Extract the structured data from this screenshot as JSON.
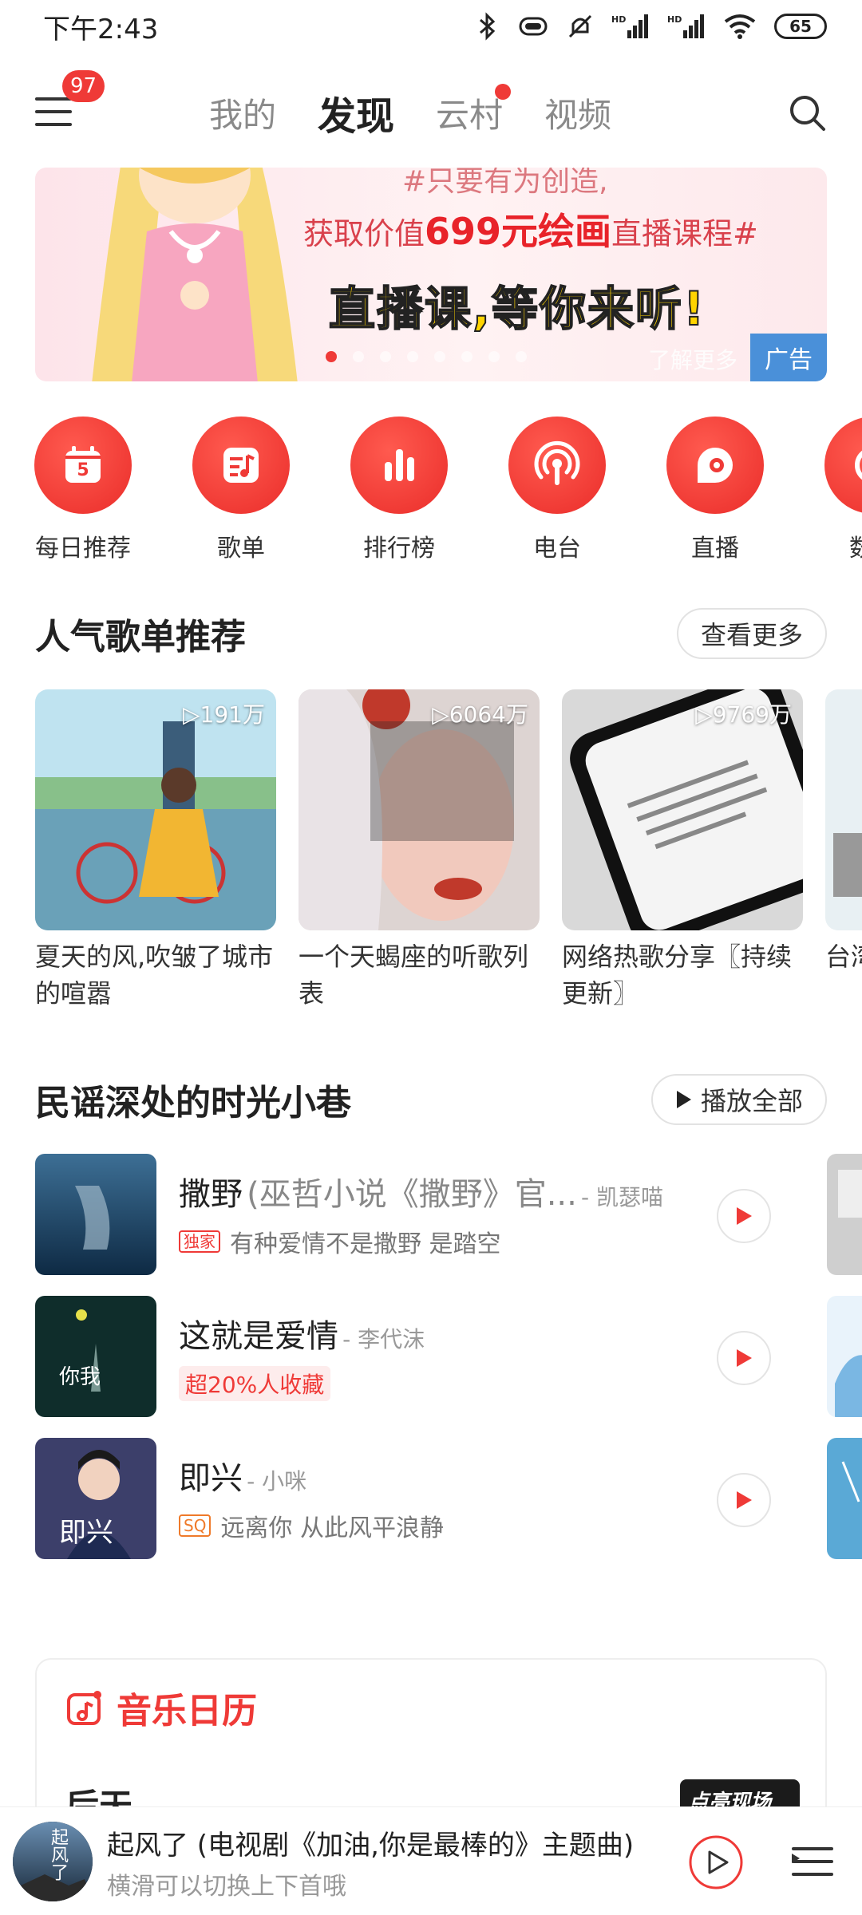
{
  "status": {
    "time": "下午2:43",
    "battery": "65"
  },
  "nav": {
    "badge": "97",
    "tabs": [
      "我的",
      "发现",
      "云村",
      "视频"
    ]
  },
  "banner": {
    "line1": "#只要有为创造,",
    "line2_prefix": "获取价值",
    "line2_highlight": "699元绘画",
    "line2_suffix": "直播课程#",
    "line3": "直播课,等你来听!",
    "more": "了解更多",
    "ad": "广告"
  },
  "quick_entries": [
    {
      "label": "每日推荐",
      "icon": "calendar-icon",
      "day": "5"
    },
    {
      "label": "歌单",
      "icon": "playlist-icon"
    },
    {
      "label": "排行榜",
      "icon": "chart-bars-icon"
    },
    {
      "label": "电台",
      "icon": "radio-icon"
    },
    {
      "label": "直播",
      "icon": "live-icon"
    },
    {
      "label": "数字",
      "icon": "digital-icon"
    }
  ],
  "popular": {
    "title": "人气歌单推荐",
    "more": "查看更多",
    "items": [
      {
        "count": "191万",
        "name": "夏天的风,吹皱了城市的喧嚣"
      },
      {
        "count": "6064万",
        "name": "一个天蝎座的听歌列表"
      },
      {
        "count": "9769万",
        "name": "网络热歌分享〖持续更新〗"
      },
      {
        "count": "",
        "name": "台湾芸知"
      }
    ]
  },
  "folk": {
    "title": "民谣深处的时光小巷",
    "play_all": "播放全部",
    "songs": [
      {
        "title": "撒野",
        "title_extra": "(巫哲小说《撒野》官...",
        "artist": "- 凯瑟喵",
        "tag": "独家",
        "desc": "有种爱情不是撒野 是踏空"
      },
      {
        "title": "这就是爱情",
        "title_extra": "",
        "artist": "- 李代沫",
        "tag": "",
        "desc": "超20%人收藏"
      },
      {
        "title": "即兴",
        "title_extra": "",
        "artist": "- 小咪",
        "tag": "SQ",
        "desc": "远离你 从此风平浪静"
      }
    ]
  },
  "calendar": {
    "title": "音乐日历",
    "item": "后天",
    "thumb_text": "点亮现场"
  },
  "player": {
    "title": "起风了 (电视剧《加油,你是最棒的》主题曲)",
    "hint": "横滑可以切换上下首哦",
    "disc_text": "起风了"
  },
  "colors": {
    "accent": "#ef3a37",
    "ad_blue": "#4a90d9"
  }
}
